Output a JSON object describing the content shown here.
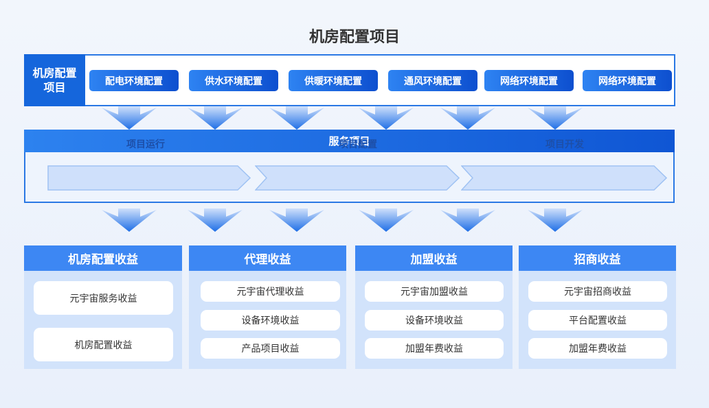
{
  "title": "机房配置项目",
  "row1": {
    "label": "机房配置项目",
    "items": [
      "配电环境配置",
      "供水环境配置",
      "供暖环境配置",
      "通风环境配置",
      "网络环境配置",
      "网络环境配置"
    ]
  },
  "row2": {
    "header": "服务项目",
    "steps": [
      "项目运行",
      "项目配置",
      "项目开发"
    ]
  },
  "cards": [
    {
      "title": "机房配置收益",
      "items": [
        "元宇宙服务收益",
        "机房配置收益"
      ]
    },
    {
      "title": "代理收益",
      "items": [
        "元宇宙代理收益",
        "设备环境收益",
        "产品项目收益"
      ]
    },
    {
      "title": "加盟收益",
      "items": [
        "元宇宙加盟收益",
        "设备环境收益",
        "加盟年费收益"
      ]
    },
    {
      "title": "招商收益",
      "items": [
        "元宇宙招商收益",
        "平台配置收益",
        "加盟年费收益"
      ]
    }
  ],
  "colors": {
    "primary": "#1566dc",
    "accent": "#3d87f3",
    "card_bg": "#d2e3fb",
    "step_fill": "#cfe0fb"
  }
}
